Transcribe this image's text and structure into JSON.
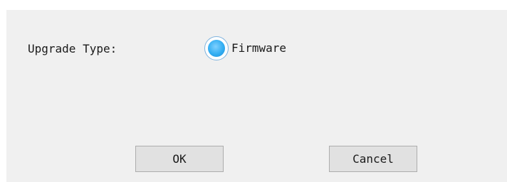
{
  "dialog": {
    "upgrade_type_label": "Upgrade Type:",
    "radio_options": [
      {
        "label": "Firmware",
        "selected": true
      }
    ],
    "ok_label": "OK",
    "cancel_label": "Cancel"
  },
  "colors": {
    "background": "#f0f0f0",
    "radio_accent": "#33aef2",
    "button_face": "#e1e1e1",
    "button_border": "#adadad"
  }
}
